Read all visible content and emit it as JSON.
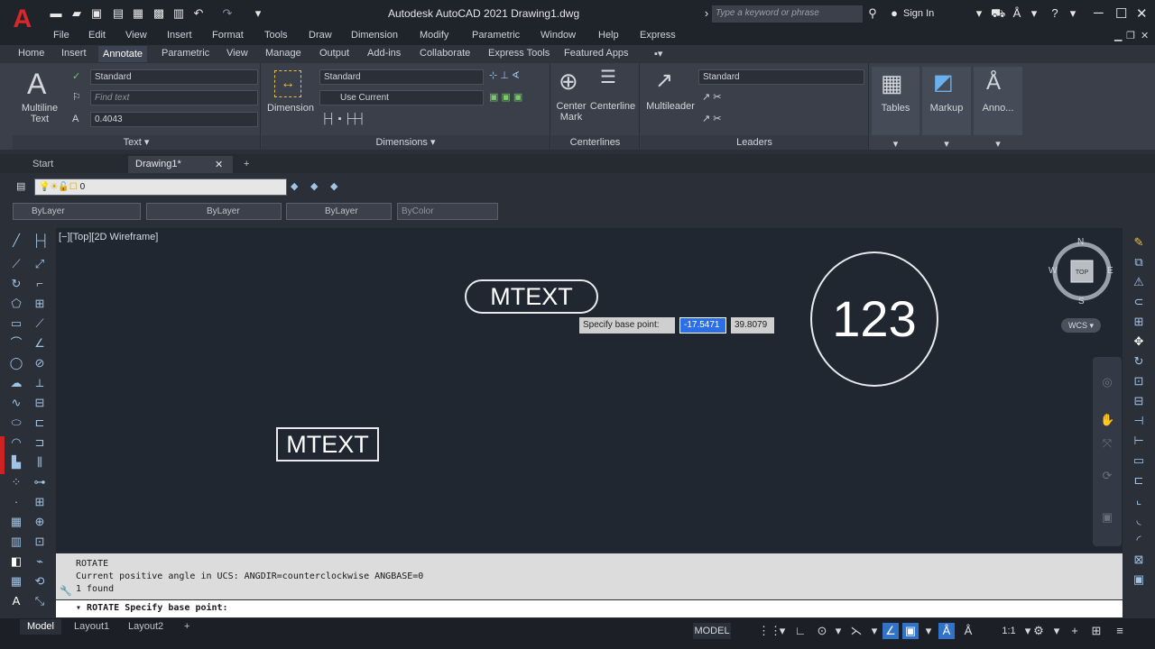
{
  "app": {
    "title": "Autodesk AutoCAD 2021   Drawing1.dwg",
    "logo": "A"
  },
  "search": {
    "placeholder": "Type a keyword or phrase"
  },
  "signin": "Sign In",
  "menu": [
    "File",
    "Edit",
    "View",
    "Insert",
    "Format",
    "Tools",
    "Draw",
    "Dimension",
    "Modify",
    "Parametric",
    "Window",
    "Help",
    "Express"
  ],
  "ribbon_tabs": [
    "Home",
    "Insert",
    "Annotate",
    "Parametric",
    "View",
    "Manage",
    "Output",
    "Add-ins",
    "Collaborate",
    "Express Tools",
    "Featured Apps"
  ],
  "active_tab": "Annotate",
  "text_panel": {
    "title": "Text ▾",
    "big_label": "Multiline\nText",
    "style": "Standard",
    "find": "Find text",
    "height": "0.4043"
  },
  "dim_panel": {
    "title": "Dimensions ▾",
    "big_label": "Dimension",
    "style": "Standard",
    "layer": "Use Current"
  },
  "centerlines_panel": {
    "title": "Centerlines",
    "center_mark": "Center\nMark",
    "centerline": "Centerline"
  },
  "leaders_panel": {
    "title": "Leaders",
    "big_label": "Multileader",
    "style": "Standard"
  },
  "tables_label": "Tables",
  "markup_label": "Markup",
  "anno_label": "Anno...",
  "doc_tabs": {
    "start": "Start",
    "drawing": "Drawing1*"
  },
  "layer": {
    "name": "0"
  },
  "properties": {
    "color": "ByLayer",
    "linetype": "ByLayer",
    "lineweight": "ByLayer",
    "plotstyle": "ByColor"
  },
  "canvas": {
    "view_label": "[−][Top][2D Wireframe]",
    "mtext_top": "MTEXT",
    "mtext_bottom": "MTEXT",
    "circle_text": "123",
    "prompt": "Specify base point:",
    "x_value": "-17.5471",
    "y_value": "39.8079",
    "compass": {
      "n": "N",
      "s": "S",
      "e": "E",
      "w": "W",
      "top": "TOP"
    },
    "wcs": "WCS ▾"
  },
  "command": {
    "history": [
      "ROTATE",
      "Current positive angle in UCS:  ANGDIR=counterclockwise  ANGBASE=0",
      "1 found"
    ],
    "current": "ROTATE Specify base point:"
  },
  "layouts": [
    "Model",
    "Layout1",
    "Layout2"
  ],
  "status": {
    "model": "MODEL",
    "scale": "1:1"
  },
  "colors": {
    "accent": "#3173c8",
    "logo": "#d8262a",
    "canvas": "#212731"
  }
}
